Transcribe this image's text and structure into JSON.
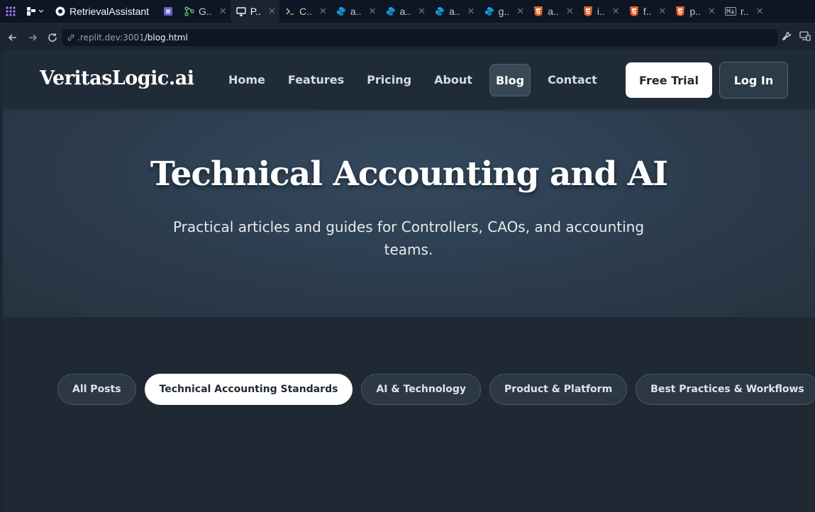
{
  "browser": {
    "app_tab": "RetrievalAssistant",
    "tabs": [
      {
        "label": "G..",
        "icon": "git-branch-icon",
        "color": "#58c77a"
      },
      {
        "label": "P..",
        "icon": "monitor-icon",
        "color": "#f5f9fc",
        "active": true
      },
      {
        "label": "C..",
        "icon": "terminal-icon",
        "color": "#e5c07b"
      },
      {
        "label": "a..",
        "icon": "python-icon",
        "color": "#1e9bd7"
      },
      {
        "label": "a..",
        "icon": "python-icon",
        "color": "#1e9bd7"
      },
      {
        "label": "a..",
        "icon": "python-icon",
        "color": "#1e9bd7"
      },
      {
        "label": "g..",
        "icon": "python-icon",
        "color": "#1e9bd7"
      },
      {
        "label": "a..",
        "icon": "html5-icon",
        "color": "#e4622b"
      },
      {
        "label": "i..",
        "icon": "html5-icon",
        "color": "#e4622b"
      },
      {
        "label": "f..",
        "icon": "html5-icon",
        "color": "#e4622b"
      },
      {
        "label": "p..",
        "icon": "html5-icon",
        "color": "#e4622b"
      },
      {
        "label": "r..",
        "icon": "markdown-icon",
        "color": "#9da2a6"
      }
    ],
    "url_host": ".replit.dev:3001",
    "url_path": "/blog.html"
  },
  "site": {
    "brand": "VeritasLogic.ai",
    "nav": [
      {
        "label": "Home"
      },
      {
        "label": "Features"
      },
      {
        "label": "Pricing"
      },
      {
        "label": "About"
      },
      {
        "label": "Blog",
        "active": true
      },
      {
        "label": "Contact"
      }
    ],
    "cta_trial": "Free Trial",
    "cta_login": "Log In"
  },
  "hero": {
    "title": "Technical Accounting and AI",
    "subtitle": "Practical articles and guides for Controllers, CAOs, and accounting teams."
  },
  "filters": [
    {
      "label": "All Posts"
    },
    {
      "label": "Technical Accounting Standards",
      "active": true
    },
    {
      "label": "AI & Technology"
    },
    {
      "label": "Product & Platform"
    },
    {
      "label": "Best Practices & Workflows"
    }
  ]
}
